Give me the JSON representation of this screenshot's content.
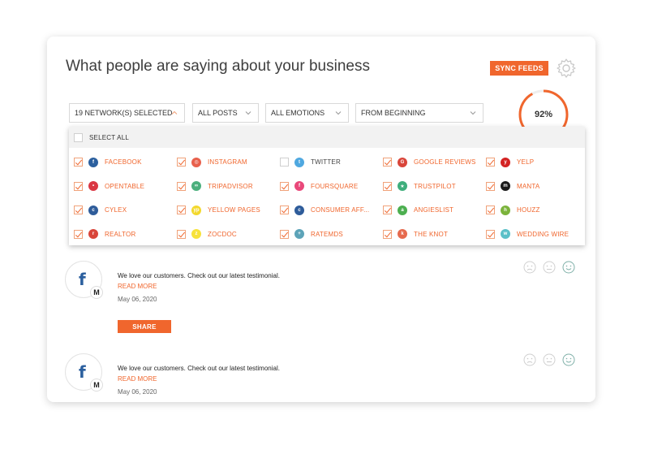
{
  "header": {
    "title": "What people are saying about your business",
    "sync_label": "SYNC FEEDS"
  },
  "filters": [
    {
      "label": "19 NETWORK(S) SELECTED",
      "open": true
    },
    {
      "label": "ALL POSTS"
    },
    {
      "label": "ALL EMOTIONS"
    },
    {
      "label": "FROM BEGINNING"
    }
  ],
  "gauge": {
    "value_text": "92%",
    "percent": 92,
    "color": "#f0662d"
  },
  "dropdown": {
    "select_all_label": "SELECT ALL",
    "networks": [
      {
        "label": "FACEBOOK",
        "checked": true,
        "color": "#2b5f9e",
        "glyph": "f"
      },
      {
        "label": "INSTAGRAM",
        "checked": true,
        "color": "#e8604c",
        "glyph": "◎"
      },
      {
        "label": "TWITTER",
        "checked": false,
        "color": "#4fa8e0",
        "glyph": "t"
      },
      {
        "label": "GOOGLE REVIEWS",
        "checked": true,
        "color": "#d9453a",
        "glyph": "G"
      },
      {
        "label": "YELP",
        "checked": true,
        "color": "#d32323",
        "glyph": "y"
      },
      {
        "label": "OPENTABLE",
        "checked": true,
        "color": "#da3743",
        "glyph": "•"
      },
      {
        "label": "TRIPADVISOR",
        "checked": true,
        "color": "#4caf7d",
        "glyph": "∞"
      },
      {
        "label": "FOURSQUARE",
        "checked": true,
        "color": "#e9487a",
        "glyph": "f"
      },
      {
        "label": "TRUSTPILOT",
        "checked": true,
        "color": "#3fae7c",
        "glyph": "★"
      },
      {
        "label": "MANTA",
        "checked": true,
        "color": "#1a1a1a",
        "glyph": "m"
      },
      {
        "label": "CYLEX",
        "checked": true,
        "color": "#2e5c9a",
        "glyph": "c"
      },
      {
        "label": "YELLOW PAGES",
        "checked": true,
        "color": "#f3d82c",
        "glyph": "yp"
      },
      {
        "label": "CONSUMER AFF...",
        "checked": true,
        "color": "#2e5c9a",
        "glyph": "c"
      },
      {
        "label": "ANGIESLIST",
        "checked": true,
        "color": "#4caf50",
        "glyph": "a"
      },
      {
        "label": "HOUZZ",
        "checked": true,
        "color": "#7bb33b",
        "glyph": "h"
      },
      {
        "label": "REALTOR",
        "checked": true,
        "color": "#d9453a",
        "glyph": "r"
      },
      {
        "label": "ZOCDOC",
        "checked": true,
        "color": "#f7e23a",
        "glyph": "z"
      },
      {
        "label": "RATEMDS",
        "checked": true,
        "color": "#5ca3b8",
        "glyph": "+"
      },
      {
        "label": "THE KNOT",
        "checked": true,
        "color": "#e66a4e",
        "glyph": "k"
      },
      {
        "label": "WEDDING WIRE",
        "checked": true,
        "color": "#5bc0c8",
        "glyph": "w"
      }
    ]
  },
  "posts": [
    {
      "network_glyph": "f",
      "badge": "M",
      "text": "We love our customers. Check out our latest testimonial.",
      "read_more": "READ MORE",
      "date": "May 06, 2020",
      "share_label": "SHARE"
    },
    {
      "network_glyph": "f",
      "badge": "M",
      "text": "We love our customers. Check out our latest testimonial.",
      "read_more": "READ MORE",
      "date": "May 06, 2020"
    }
  ]
}
